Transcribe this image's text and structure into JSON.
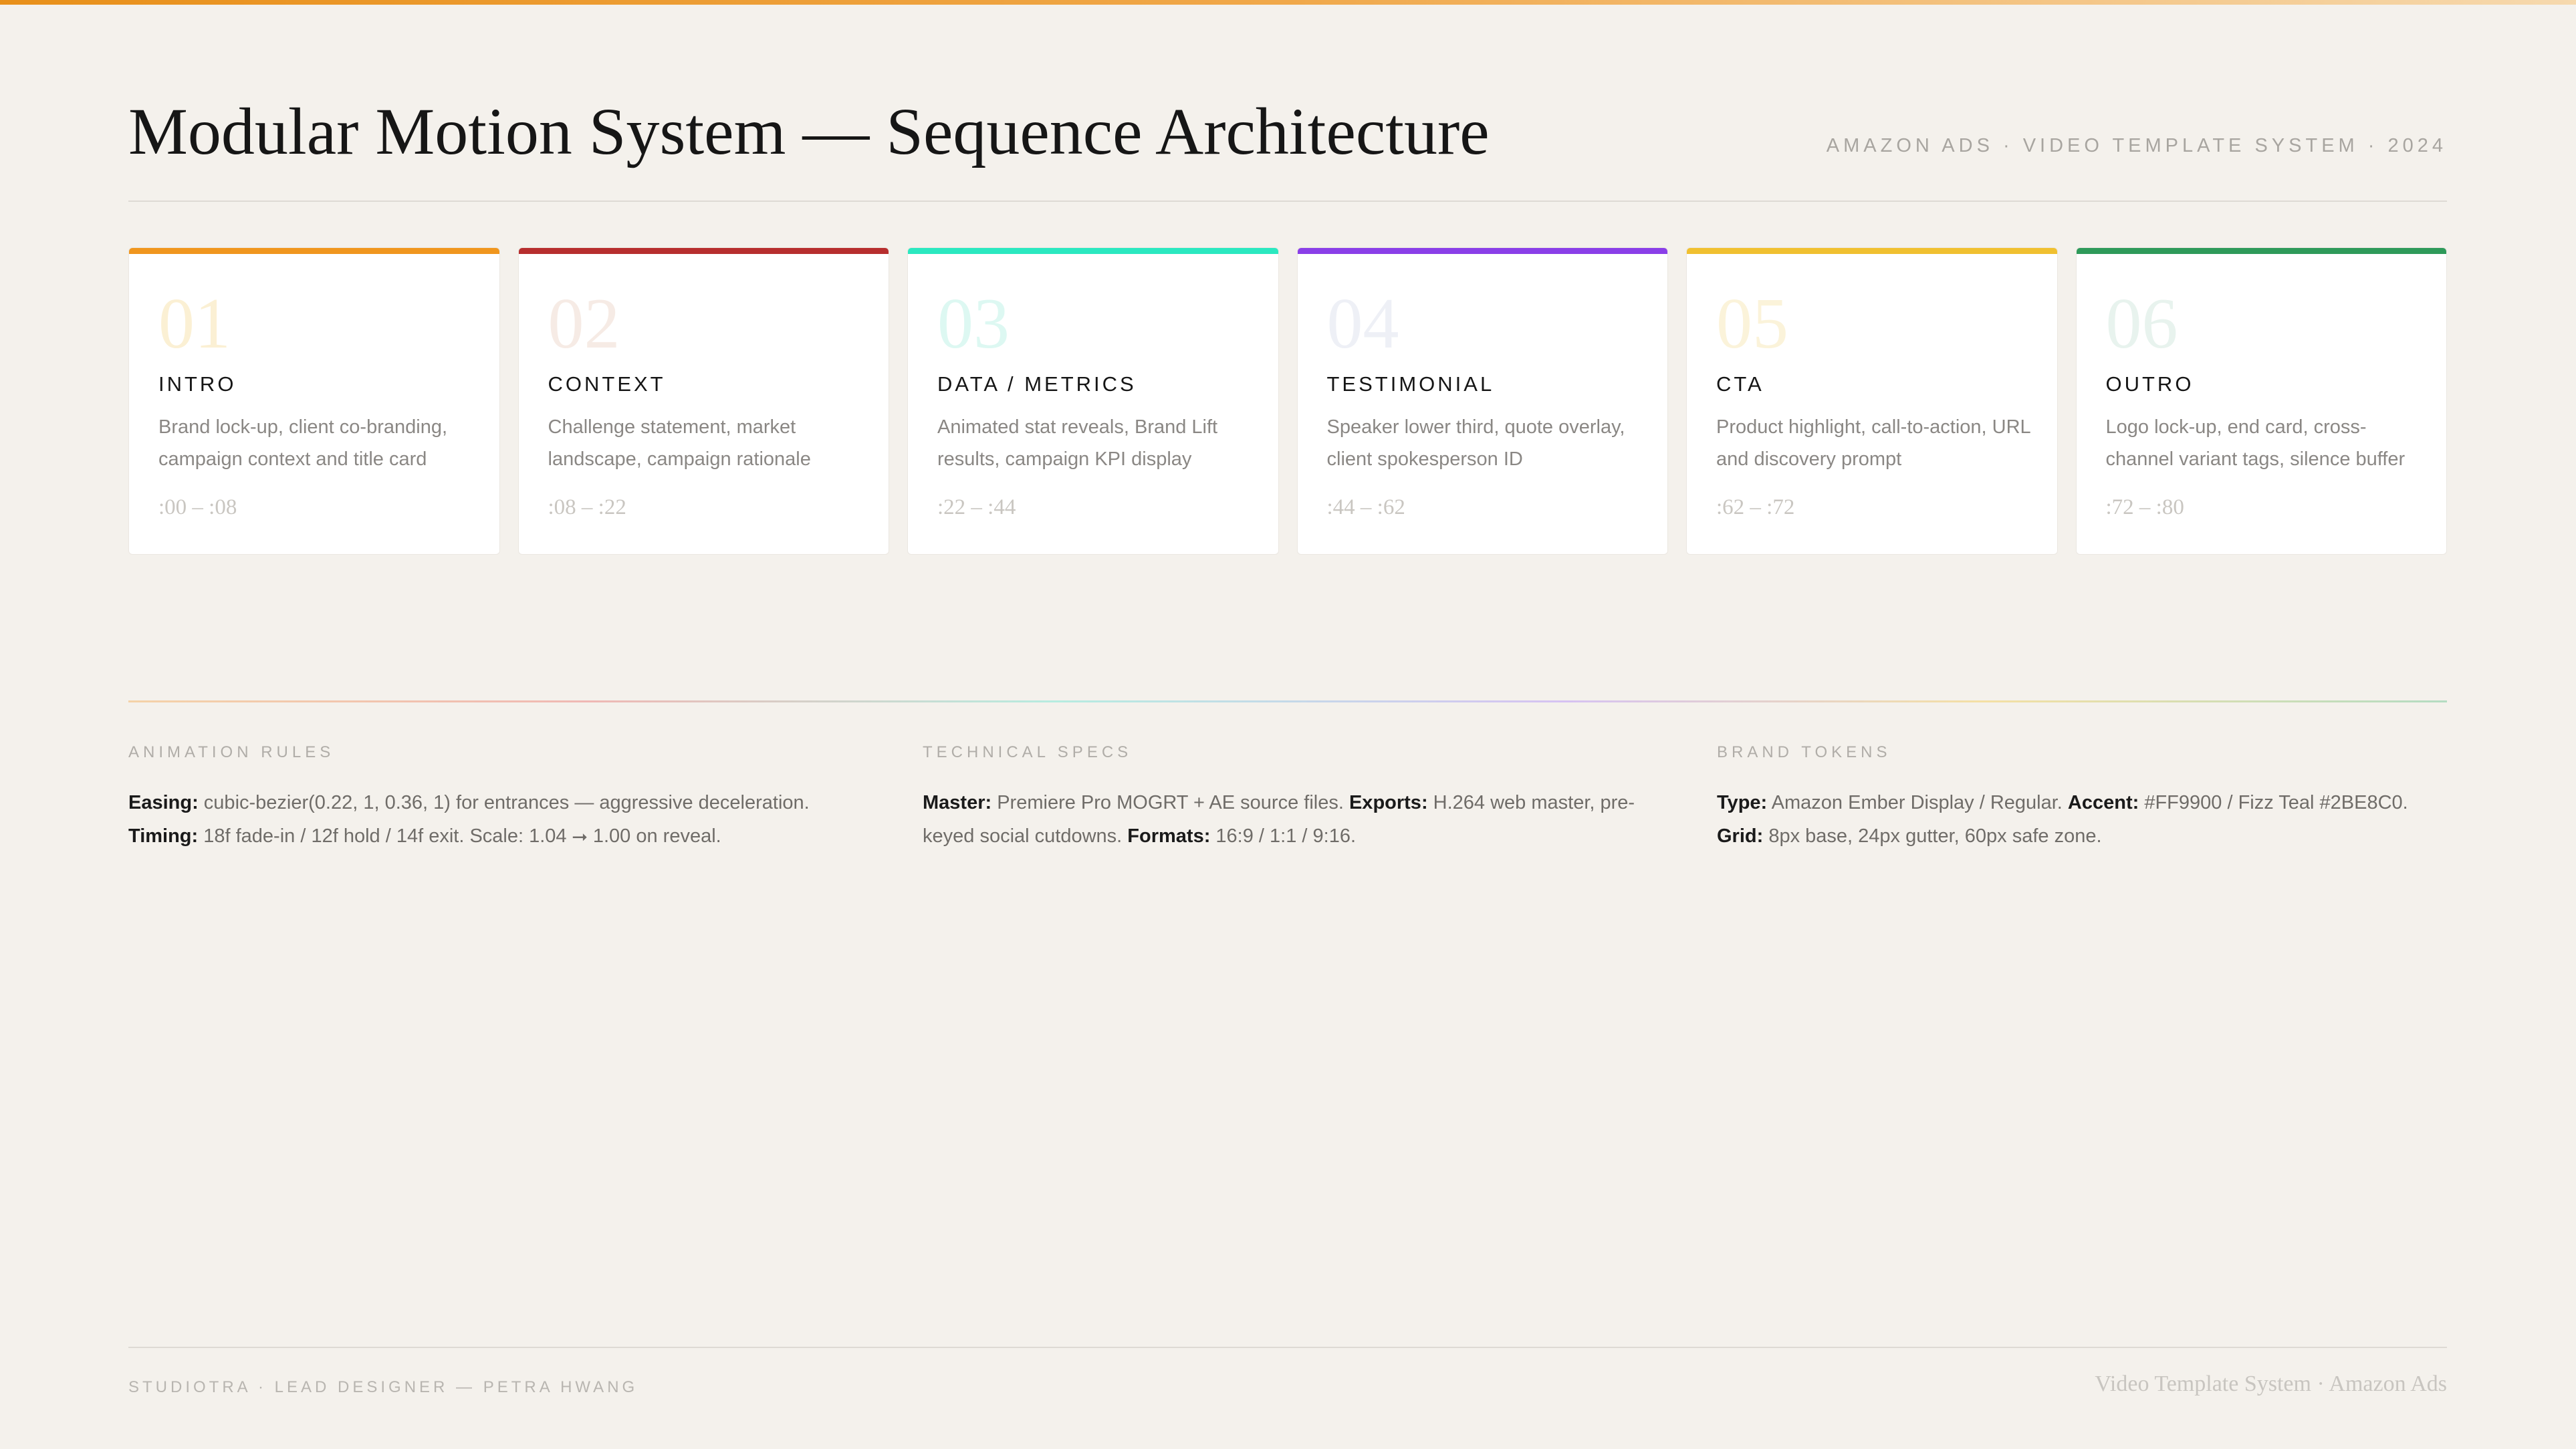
{
  "header": {
    "title": "Modular Motion System — Sequence Architecture",
    "meta": "AMAZON ADS · VIDEO TEMPLATE SYSTEM · 2024"
  },
  "cards": [
    {
      "num": "01",
      "name": "INTRO",
      "desc": "Brand lock-up, client co-branding, campaign context and title card",
      "time": ":00 – :08",
      "accent": "#F0961E",
      "num_color": "#FBF0D4"
    },
    {
      "num": "02",
      "name": "CONTEXT",
      "desc": "Challenge statement, market landscape, campaign rationale",
      "time": ":08 – :22",
      "accent": "#B72E2E",
      "num_color": "#F6EBE5"
    },
    {
      "num": "03",
      "name": "DATA / METRICS",
      "desc": "Animated stat reveals, Brand Lift results, campaign KPI display",
      "time": ":22 – :44",
      "accent": "#2BE8C0",
      "num_color": "#DDF8F2"
    },
    {
      "num": "04",
      "name": "TESTIMONIAL",
      "desc": "Speaker lower third, quote overlay, client spokesperson ID",
      "time": ":44 – :62",
      "accent": "#8A3FE8",
      "num_color": "#EEF0F6"
    },
    {
      "num": "05",
      "name": "CTA",
      "desc": "Product highlight, call-to-action, URL and discovery prompt",
      "time": ":62 – :72",
      "accent": "#F0C030",
      "num_color": "#FBF3DA"
    },
    {
      "num": "06",
      "name": "OUTRO",
      "desc": "Logo lock-up, end card, cross-channel variant tags, silence buffer",
      "time": ":72 – :80",
      "accent": "#2E9A5A",
      "num_color": "#E8F3EE"
    }
  ],
  "sections": [
    {
      "heading": "ANIMATION RULES",
      "lines": [
        [
          {
            "k": "Easing:",
            "v": " cubic-bezier(0.22, 1, 0.36, 1) for entrances — aggressive deceleration."
          }
        ],
        [
          {
            "k": "Timing:",
            "v": " 18f fade-in / 12f hold / 14f exit. Scale: 1.04 ⭢ 1.00 on reveal."
          }
        ]
      ]
    },
    {
      "heading": "TECHNICAL SPECS",
      "lines": [
        [
          {
            "k": "Master:",
            "v": " Premiere Pro MOGRT + AE source files. "
          },
          {
            "k": "Exports:",
            "v": " H.264 web master, pre-keyed social cutdowns. "
          },
          {
            "k": "Formats:",
            "v": " 16:9 / 1:1 / 9:16."
          }
        ]
      ]
    },
    {
      "heading": "BRAND TOKENS",
      "lines": [
        [
          {
            "k": "Type:",
            "v": " Amazon Ember Display / Regular. "
          },
          {
            "k": "Accent:",
            "v": " #FF9900 / Fizz Teal #2BE8C0."
          }
        ],
        [
          {
            "k": "Grid:",
            "v": " 8px base, 24px gutter, 60px safe zone."
          }
        ]
      ]
    }
  ],
  "footer": {
    "left": "STUDIOTRA · LEAD DESIGNER — PETRA HWANG",
    "right": "Video Template System · Amazon Ads"
  }
}
